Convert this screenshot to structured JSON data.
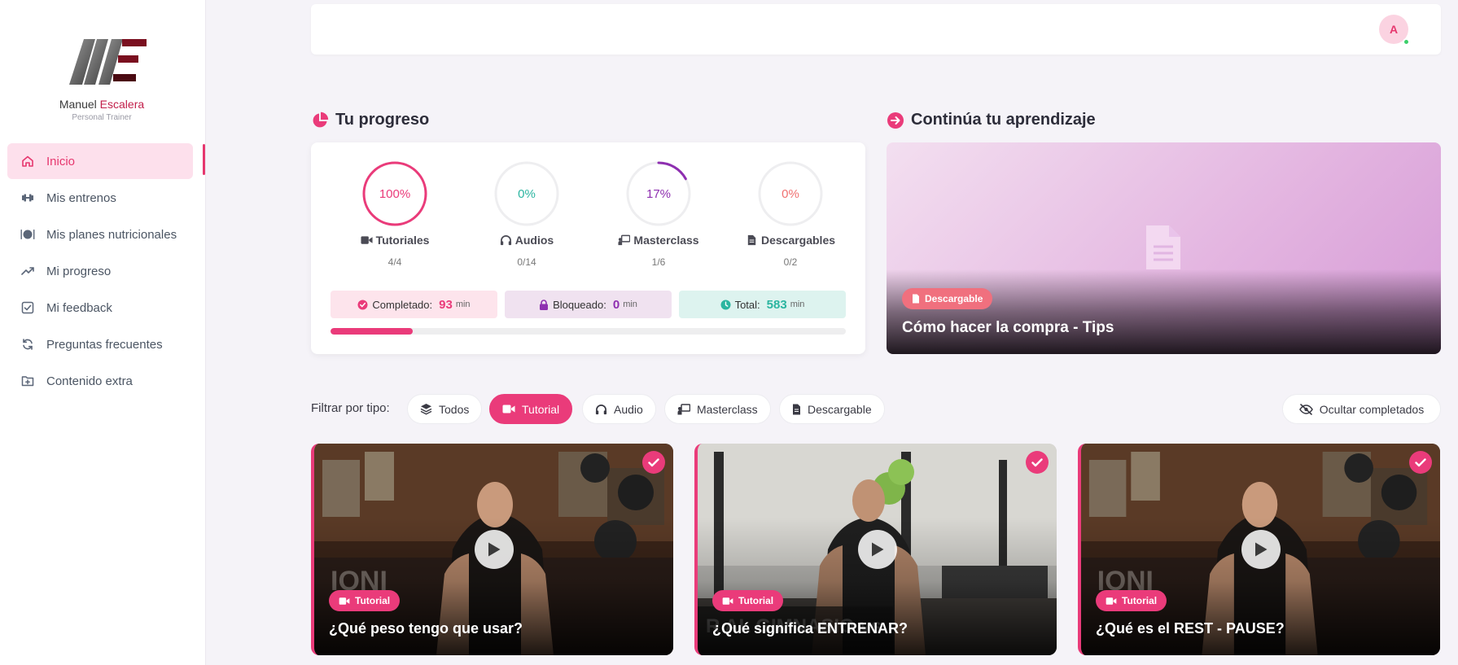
{
  "brand": {
    "name_first": "Manuel",
    "name_last": "Escalera",
    "subtitle": "Personal Trainer"
  },
  "sidebar": {
    "items": [
      {
        "label": "Inicio",
        "icon": "home-icon",
        "active": true
      },
      {
        "label": "Mis entrenos",
        "icon": "dumbbell-icon"
      },
      {
        "label": "Mis planes nutricionales",
        "icon": "plate-icon"
      },
      {
        "label": "Mi progreso",
        "icon": "trend-icon"
      },
      {
        "label": "Mi feedback",
        "icon": "checkbox-icon"
      },
      {
        "label": "Preguntas frecuentes",
        "icon": "refresh-icon"
      },
      {
        "label": "Contenido extra",
        "icon": "folder-plus-icon"
      }
    ]
  },
  "header": {
    "avatar_initial": "A"
  },
  "progress": {
    "title": "Tu progreso",
    "stats": [
      {
        "percent_label": "100%",
        "percent": 100,
        "label": "Tutoriales",
        "count": "4/4",
        "color": "#ea3b7a",
        "icon": "video-icon"
      },
      {
        "percent_label": "0%",
        "percent": 0,
        "label": "Audios",
        "count": "0/14",
        "color": "#2bb5a0",
        "icon": "headphones-icon"
      },
      {
        "percent_label": "17%",
        "percent": 17,
        "label": "Masterclass",
        "count": "1/6",
        "color": "#8e2fb0",
        "icon": "presentation-icon"
      },
      {
        "percent_label": "0%",
        "percent": 0,
        "label": "Descargables",
        "count": "0/2",
        "color": "#f07070",
        "icon": "file-icon"
      }
    ],
    "summary": {
      "completed_label": "Completado:",
      "completed_value": "93",
      "locked_label": "Bloqueado:",
      "locked_value": "0",
      "total_label": "Total:",
      "total_value": "583",
      "unit": "min"
    },
    "bar_fraction": 0.16
  },
  "continue": {
    "title": "Continúa tu aprendizaje",
    "badge": "Descargable",
    "item_title": "Cómo hacer la compra - Tips"
  },
  "filters": {
    "label": "Filtrar por tipo:",
    "chips": [
      {
        "label": "Todos",
        "icon": "layers-icon"
      },
      {
        "label": "Tutorial",
        "icon": "video-icon",
        "active": true
      },
      {
        "label": "Audio",
        "icon": "headphones-icon"
      },
      {
        "label": "Masterclass",
        "icon": "presentation-icon"
      },
      {
        "label": "Descargable",
        "icon": "file-icon"
      }
    ],
    "hide_completed": "Ocultar completados"
  },
  "videos": [
    {
      "badge": "Tutorial",
      "title": "¿Qué peso tengo que usar?"
    },
    {
      "badge": "Tutorial",
      "title": "¿Qué significa ENTRENAR?"
    },
    {
      "badge": "Tutorial",
      "title": "¿Qué es el REST - PAUSE?"
    }
  ],
  "colors": {
    "accent": "#ea3b7a",
    "teal": "#2bb5a0",
    "purple": "#8e2fb0",
    "salmon": "#f07070"
  }
}
